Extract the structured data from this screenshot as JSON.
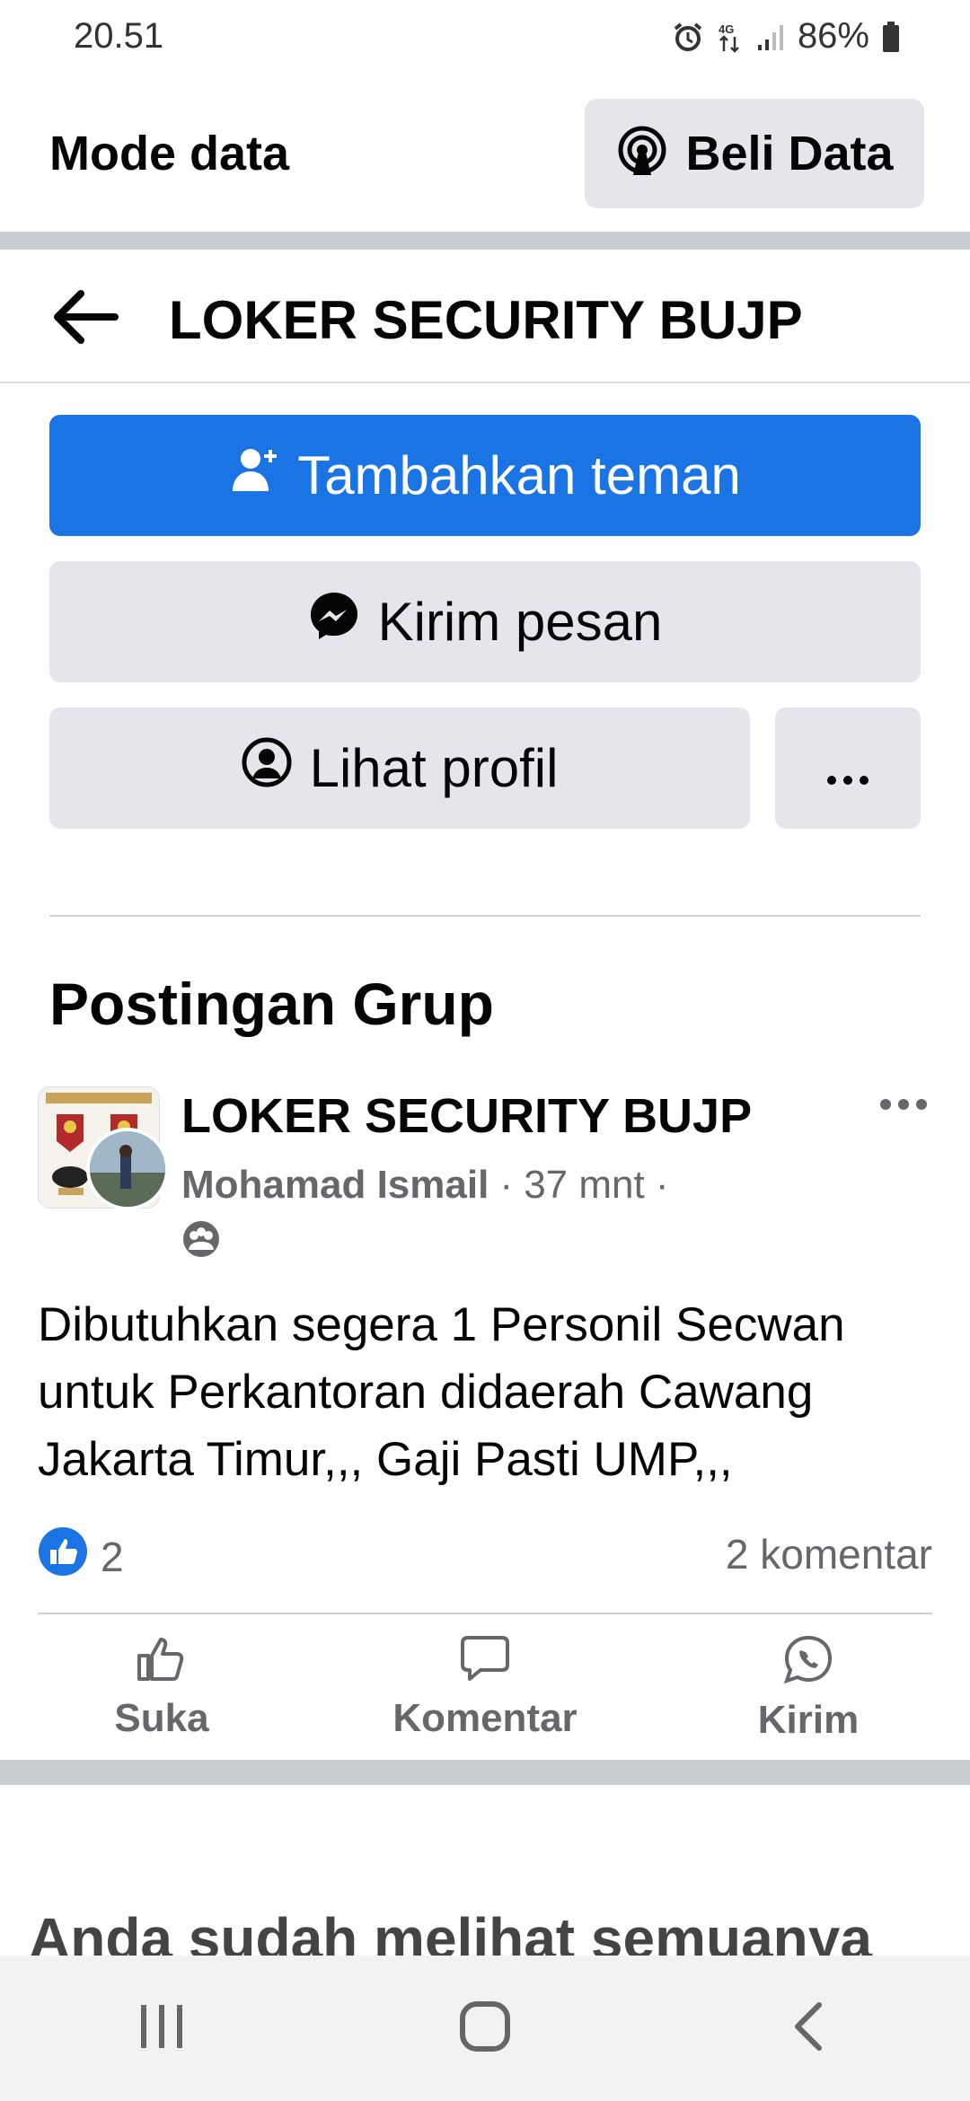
{
  "status_bar": {
    "time": "20.51",
    "battery": "86%"
  },
  "data_mode": {
    "title": "Mode data",
    "buy_label": "Beli Data"
  },
  "header": {
    "title": "LOKER SECURITY BUJP"
  },
  "actions": {
    "add_friend": "Tambahkan teman",
    "message": "Kirim pesan",
    "view_profile": "Lihat profil",
    "more": "···"
  },
  "section": {
    "title": "Postingan Grup"
  },
  "post": {
    "group": "LOKER SECURITY BUJP",
    "author": "Mohamad Ismail",
    "time": "· 37 mnt ·",
    "text": "Dibutuhkan segera 1 Personil Secwan untuk Perkantoran didaerah Cawang Jakarta Timur,,, Gaji Pasti UMP,,,",
    "likes": "2",
    "comments": "2 komentar",
    "like_label": "Suka",
    "comment_label": "Komentar",
    "send_label": "Kirim"
  },
  "end_message": "Anda sudah melihat semuanya",
  "colors": {
    "primary": "#1b74e4",
    "secondary_bg": "#e4e6eb",
    "muted_text": "#65676b"
  },
  "icons": [
    "alarm-icon",
    "signal-icon",
    "battery-icon",
    "hotspot-icon",
    "back-arrow-icon",
    "add-person-icon",
    "messenger-icon",
    "profile-icon",
    "more-icon",
    "group-icon",
    "like-icon",
    "comment-icon",
    "whatsapp-icon",
    "recent-apps-icon",
    "home-icon",
    "nav-back-icon"
  ]
}
